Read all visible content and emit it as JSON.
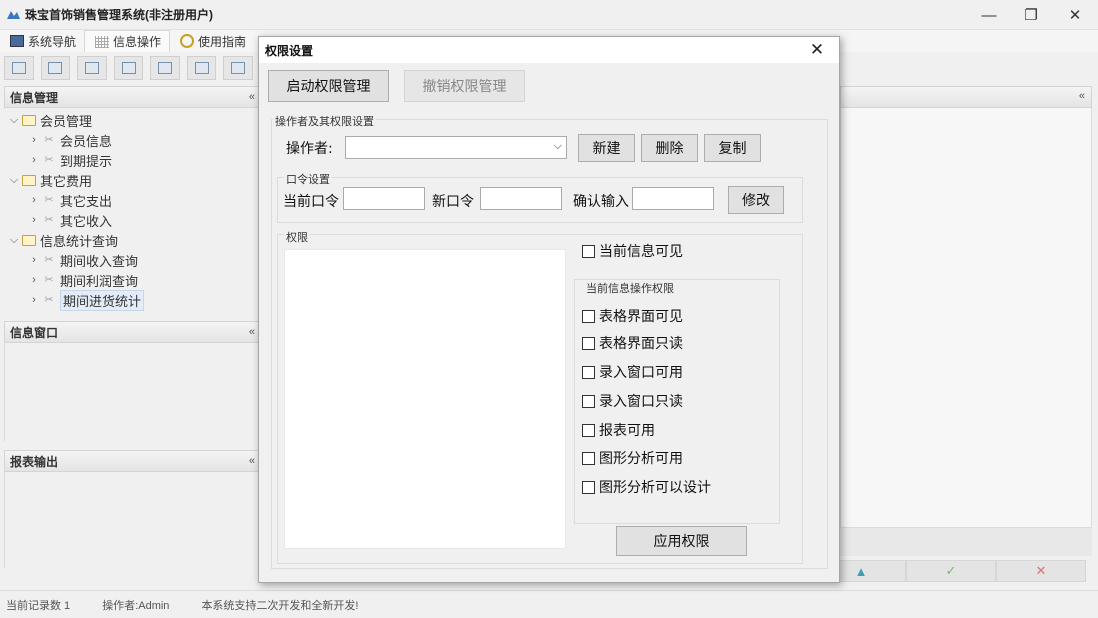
{
  "window": {
    "title": "珠宝首饰销售管理系统(非注册用户)",
    "controls": {
      "minimize": "—",
      "restore": "❐",
      "close": "✕"
    }
  },
  "menu": {
    "tabs": [
      {
        "label": "系统导航"
      },
      {
        "label": "信息操作"
      },
      {
        "label": "使用指南"
      }
    ]
  },
  "left": {
    "info_panel": {
      "title": "信息管理",
      "collapse": "«"
    },
    "tree": [
      {
        "label": "会员管理",
        "type": "folder",
        "expanded": true
      },
      {
        "label": "会员信息",
        "type": "leaf"
      },
      {
        "label": "到期提示",
        "type": "leaf"
      },
      {
        "label": "其它费用",
        "type": "folder",
        "expanded": true
      },
      {
        "label": "其它支出",
        "type": "leaf"
      },
      {
        "label": "其它收入",
        "type": "leaf"
      },
      {
        "label": "信息统计查询",
        "type": "folder",
        "expanded": true
      },
      {
        "label": "期间收入查询",
        "type": "leaf"
      },
      {
        "label": "期间利润查询",
        "type": "leaf"
      },
      {
        "label": "期间进货统计",
        "type": "leaf",
        "selected": true
      }
    ],
    "window_panel": {
      "title": "信息窗口",
      "collapse": "«"
    },
    "report_panel": {
      "title": "报表输出",
      "collapse": "«"
    }
  },
  "right": {
    "collapse": "«",
    "buttons": [
      "▲",
      "✓",
      "✕"
    ]
  },
  "status": {
    "record_count": "当前记录数 1",
    "operator": "操作者:Admin",
    "message": "本系统支持二次开发和全新开发!"
  },
  "dialog": {
    "title": "权限设置",
    "close": "✕",
    "enable_button": "启动权限管理",
    "revoke_button": "撤销权限管理",
    "operator_group": {
      "title": "操作者及其权限设置",
      "operator_label": "操作者:",
      "operator_value": "",
      "new_button": "新建",
      "delete_button": "删除",
      "copy_button": "复制"
    },
    "password_group": {
      "title": "口令设置",
      "current_label": "当前口令",
      "new_label": "新口令",
      "confirm_label": "确认输入",
      "modify_button": "修改"
    },
    "permission_group": {
      "title": "权限",
      "current_visible": "当前信息可见",
      "ops_title": "当前信息操作权限",
      "options": [
        {
          "label": "表格界面可见",
          "checked": false
        },
        {
          "label": "表格界面只读",
          "checked": false
        },
        {
          "label": "录入窗口可用",
          "checked": false
        },
        {
          "label": "录入窗口只读",
          "checked": false
        },
        {
          "label": "报表可用",
          "checked": false
        },
        {
          "label": "图形分析可用",
          "checked": false
        },
        {
          "label": "图形分析可以设计",
          "checked": false
        }
      ],
      "apply_button": "应用权限"
    }
  },
  "colors": {
    "accent": "#1f77c8",
    "background": "#f0f0f0",
    "selected": "#e3ecf7"
  }
}
